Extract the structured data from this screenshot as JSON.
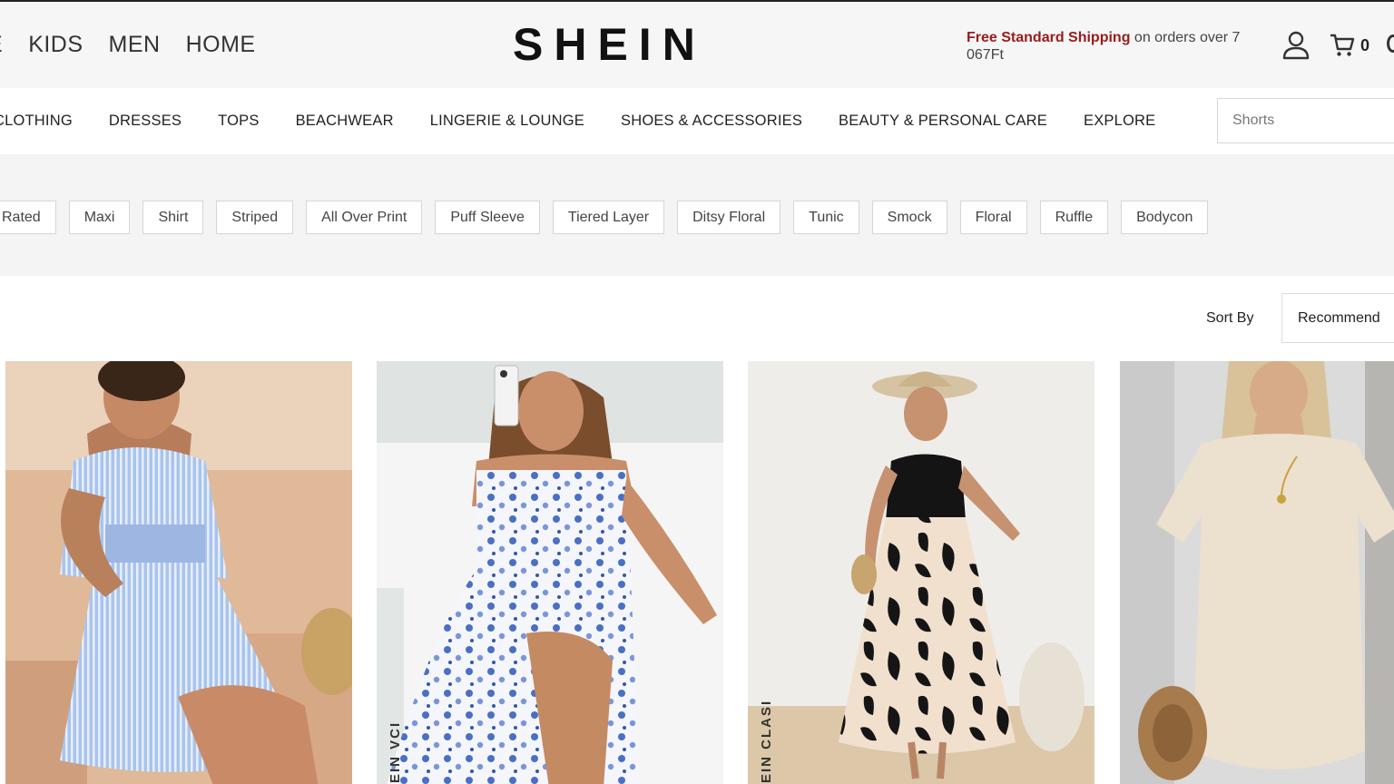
{
  "header": {
    "top_nav": [
      "E",
      "KIDS",
      "MEN",
      "HOME"
    ],
    "logo": "SHEIN",
    "shipping_highlight": "Free Standard Shipping",
    "shipping_rest": " on orders over 7",
    "shipping_line2": "067Ft",
    "cart_count": "0"
  },
  "categories": [
    "CLOTHING",
    "DRESSES",
    "TOPS",
    "BEACHWEAR",
    "LINGERIE & LOUNGE",
    "SHOES & ACCESSORIES",
    "BEAUTY & PERSONAL CARE",
    "EXPLORE"
  ],
  "search": {
    "placeholder": "Shorts"
  },
  "filters": [
    "Rated",
    "Maxi",
    "Shirt",
    "Striped",
    "All Over Print",
    "Puff Sleeve",
    "Tiered Layer",
    "Ditsy Floral",
    "Tunic",
    "Smock",
    "Floral",
    "Ruffle",
    "Bodycon"
  ],
  "sort": {
    "label": "Sort By",
    "selected": "Recommend"
  },
  "products": [
    {
      "image": "striped-blue-ruffle-sleeve-dress"
    },
    {
      "image": "blue-floral-puff-sleeve-maxi-dress",
      "watermark": "EIN VCI"
    },
    {
      "image": "black-cream-leaf-print-maxi-dress",
      "watermark": "EIN CLASI"
    },
    {
      "image": "beige-tshirt-dress"
    }
  ],
  "colors": {
    "brand": "#111111",
    "shipping_accent": "#9b1b1b",
    "header_bg": "#f6f6f6",
    "filter_bg": "#f4f4f4"
  }
}
